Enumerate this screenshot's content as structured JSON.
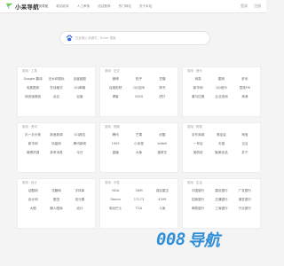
{
  "header": {
    "brand": "小呆导航",
    "nav": [
      "首页导航",
      "新站收录",
      "人工审核",
      "优站推荐",
      "热门网站",
      "关于本站"
    ],
    "active_nav": 0,
    "right": [
      "登录",
      "注册"
    ]
  },
  "search": {
    "placeholder": "在此输入关键字，Enter 搜索"
  },
  "panels": [
    {
      "title": "常用 · 工具",
      "links": [
        "Google 翻译",
        "无水印图标",
        "百度脑图",
        "免费图床",
        "在线格式",
        "QQ邮箱",
        "网页版微信",
        "必应",
        "百度"
      ],
      "hl": []
    },
    {
      "title": "常用 · 社交",
      "links": [
        "微博",
        "知乎",
        "豆瓣",
        "百度贴吧",
        "QQ空间",
        "简书",
        "博客",
        "V2EX",
        "虎扑"
      ],
      "hl": []
    },
    {
      "title": "常用 · 音乐",
      "links": [
        "网易",
        "酷狗",
        "虾米",
        "新华网",
        "QQ音乐",
        "荔枝FM",
        "喜马拉雅",
        "企业查询",
        "滴滴"
      ],
      "hl": []
    },
    {
      "title": "常用 · 资讯",
      "links": [
        "扒一扒头条",
        "新浪新闻",
        "GQ报告",
        "新华网",
        "凤凰网",
        "腾讯新闻",
        "微博热搜",
        "参考消息",
        "今日"
      ],
      "hl": []
    },
    {
      "title": "常用 · 视频",
      "links": [
        "腾讯",
        "芒果",
        "优酷",
        "1905",
        "小米视",
        "bilibili",
        "直播",
        "大鱼",
        "爱奇艺"
      ],
      "hl": []
    },
    {
      "title": "常用 · 购物",
      "links": [
        "京东商城",
        "唯品会",
        "淘宝",
        "一号店",
        "天猫",
        "当当",
        "美丽说",
        "聚美优品",
        "苏宁"
      ],
      "hl": []
    },
    {
      "title": "常用 · 设计",
      "links": [
        "站酷网",
        "花瓣网",
        "字体库",
        "设计网",
        "图虫",
        "觅元素",
        "大图",
        "懒人图库",
        "设计"
      ],
      "hl": []
    },
    {
      "title": "常用 · 开发",
      "links": [
        "NGA",
        "3DM",
        "游民星空",
        "Steam",
        "17173",
        "4399",
        "电玩巴士",
        "TGA",
        "斗鱼"
      ],
      "hl": []
    },
    {
      "title": "常用 · 生活",
      "links": [
        "中国银行",
        "建设银行",
        "广发银行",
        "招商银行",
        "交通银行",
        "浦发银行",
        "邮政银行",
        "工商银行",
        "兴业银行"
      ],
      "hl": []
    }
  ],
  "footer": {
    "brand_num": "008",
    "brand_cn": "导航"
  }
}
